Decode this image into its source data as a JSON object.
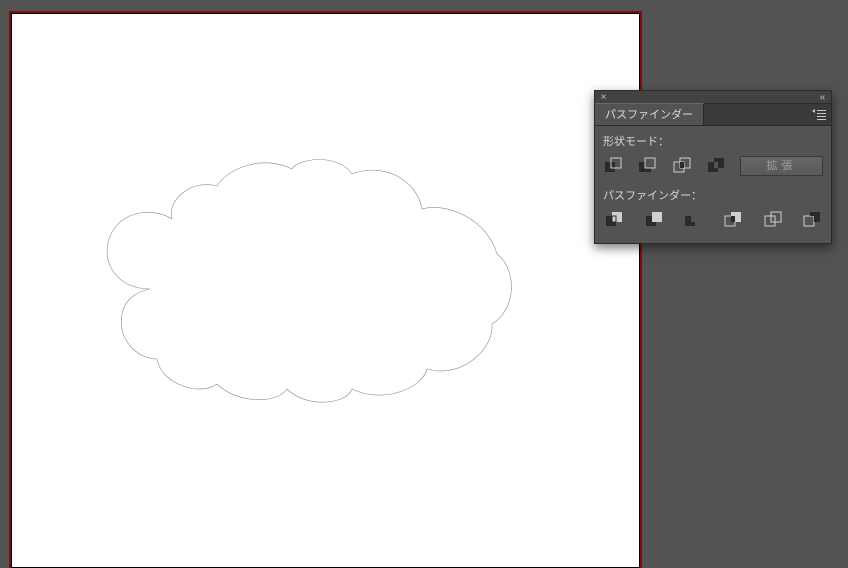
{
  "panel": {
    "title_tab": "パスファインダー",
    "section_shape_mode": "形状モード：",
    "section_pathfinder": "パスファインダー：",
    "expand_label": "拡張",
    "close_glyph": "×",
    "collapse_glyph": "«",
    "shape_mode_buttons": [
      {
        "name": "unite-icon"
      },
      {
        "name": "minus-front-icon"
      },
      {
        "name": "intersect-icon"
      },
      {
        "name": "exclude-icon"
      }
    ],
    "pathfinder_buttons": [
      {
        "name": "divide-icon"
      },
      {
        "name": "trim-icon"
      },
      {
        "name": "merge-icon"
      },
      {
        "name": "crop-icon"
      },
      {
        "name": "outline-icon"
      },
      {
        "name": "minus-back-icon"
      }
    ]
  }
}
